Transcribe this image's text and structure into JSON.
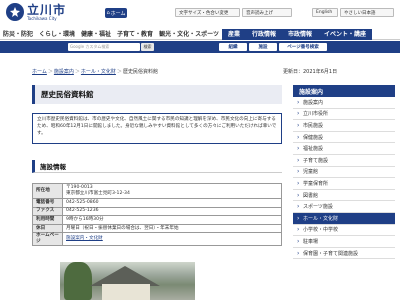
{
  "header": {
    "logo_jp": "立川市",
    "logo_en": "Tachikawa City",
    "home_label": "ホーム",
    "util": [
      "文字サイズ・色合い変更",
      "音声読み上げ",
      "English",
      "やさしい日本語"
    ]
  },
  "gnav": [
    "防災・防犯",
    "くらし・環境",
    "健康・福祉",
    "子育て・教育",
    "観光・文化・スポーツ",
    "産業",
    "行政情報",
    "市政情報",
    "イベント・講座"
  ],
  "search": {
    "placeholder": "Google カスタム検索",
    "button": "検索",
    "links": [
      "組織",
      "施設",
      "ページ番号検索"
    ]
  },
  "breadcrumb": [
    "ホーム",
    "施設案内",
    "ホール・文化財",
    "歴史民俗資料館"
  ],
  "update": "更新日：2021年6月1日",
  "page_title": "歴史民俗資料館",
  "intro": "立川市歴史民俗資料館は、市の歴史や文化、自然風土に関する市民の知識と理解を深め、市民文化の向上に寄与するため、昭和60年12月1日に開館しました。身近な親しみやすい資料館として多くの方々にご利用いただければ幸いです。",
  "section_title": "施設情報",
  "info": [
    {
      "label": "所在地",
      "value": "〒190-0013\n東京都立川市富士見町3-12-34"
    },
    {
      "label": "電話番号",
      "value": "042-525-0860"
    },
    {
      "label": "ファクス",
      "value": "042-525-1236"
    },
    {
      "label": "利用時間",
      "value": "9時から16時30分"
    },
    {
      "label": "休日",
      "value": "月曜日（祝日・振替休業日の場合は、翌日）・年末年始"
    },
    {
      "label": "ホームページ",
      "value": "施設案内・文化財"
    }
  ],
  "sidebar": {
    "head": "施設案内",
    "items": [
      "施設案内",
      "立川市役所",
      "市民施設",
      "保健施設",
      "福祉施設",
      "子育て施設",
      "児童館",
      "学童保育所",
      "図書館",
      "スポーツ施設",
      "ホール・文化財",
      "小学校・中学校",
      "駐車場",
      "保育園・子育て関連施設"
    ],
    "active_index": 10
  }
}
